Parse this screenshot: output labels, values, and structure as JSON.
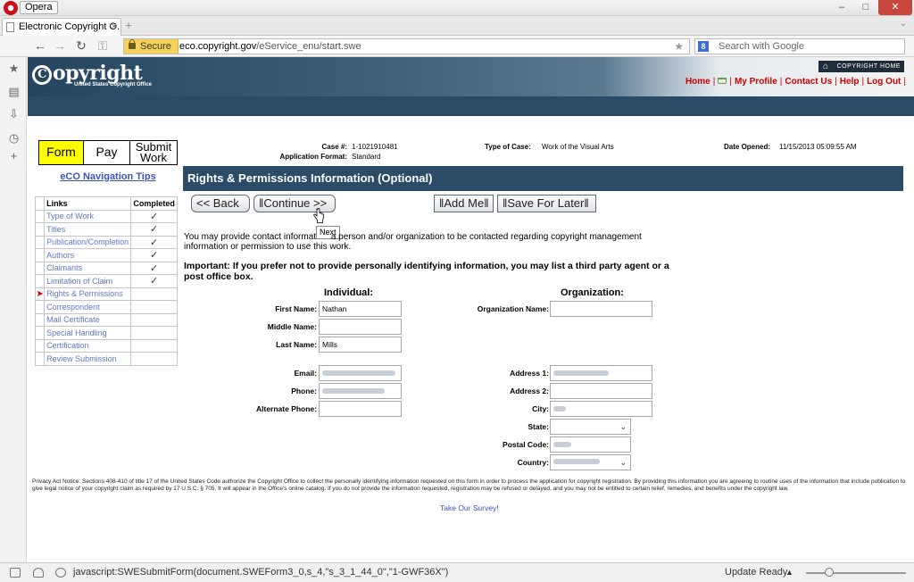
{
  "browser": {
    "menu_label": "Opera",
    "window_controls": {
      "minimize": "–",
      "maximize": "□",
      "close": "✕"
    },
    "tab_title": "Electronic Copyright O...",
    "tab_close": "×",
    "new_tab": "+",
    "secure_label": "Secure",
    "url_domain": "eco.copyright.gov",
    "url_path": "/eService_enu/start.swe",
    "search_placeholder": "Search with Google",
    "search_engine_letter": "8",
    "status_text": "javascript:SWESubmitForm(document.SWEForm3_0,s_4,\"s_3_1_44_0\",\"1-GWF36X\")",
    "update_text": "Update Ready",
    "zoom_level": 0.23,
    "icons": [
      "opera-logo",
      "back-icon",
      "forward-icon",
      "reload-icon",
      "key-icon",
      "lock-icon",
      "star-icon",
      "bookmarks-icon",
      "notes-icon",
      "downloads-icon",
      "history-icon",
      "plus-icon"
    ]
  },
  "site": {
    "logo_text": "opyright",
    "logo_letter": "C",
    "logo_subtitle": "United States Copyright Office",
    "copyright_home": "COPYRIGHT HOME",
    "links": {
      "home": "Home",
      "profile": "My Profile",
      "contact": "Contact Us",
      "help": "Help",
      "logout": "Log Out"
    },
    "link_color": "#cc0000",
    "banner_color": "#2a4a66"
  },
  "nav": {
    "steps": {
      "form": "Form",
      "pay": "Pay",
      "submit_line1": "Submit",
      "submit_line2": "Work"
    },
    "tips": "eCO Navigation Tips",
    "table_headers": {
      "links": "Links",
      "completed": "Completed"
    },
    "check_mark": "✓",
    "current_marker": "➤",
    "items": [
      {
        "label": "Type of Work",
        "completed": true
      },
      {
        "label": "Titles",
        "completed": true
      },
      {
        "label": "Publication/Completion",
        "completed": true
      },
      {
        "label": "Authors",
        "completed": true
      },
      {
        "label": "Claimants",
        "completed": true
      },
      {
        "label": "Limitation of Claim",
        "completed": true
      },
      {
        "label": "Rights & Permissions",
        "completed": false,
        "current": true
      },
      {
        "label": "Correspondent",
        "completed": false
      },
      {
        "label": "Mail Certificate",
        "completed": false
      },
      {
        "label": "Special Handling",
        "completed": false
      },
      {
        "label": "Certification",
        "completed": false
      },
      {
        "label": "Review Submission",
        "completed": false
      }
    ]
  },
  "case": {
    "case_label": "Case #:",
    "case_value": "1-1021910481",
    "format_label": "Application Format:",
    "format_value": "Standard",
    "type_label": "Type of Case:",
    "type_value": "Work of the Visual Arts",
    "opened_label": "Date Opened:",
    "opened_value": "11/15/2013 05:09:55 AM"
  },
  "section": {
    "title": "Rights & Permissions Information (Optional)",
    "buttons": {
      "back": "<< Back",
      "continue": "Continue >>",
      "add_me": "Add Me",
      "save_later": "Save For Later"
    },
    "tooltip": "Next",
    "intro_a": "You may provide contact informat",
    "intro_b": " a person and/or organization to be contacted regarding copyright management information or permission to use this work.",
    "important": "Important: If you prefer not to provide personally identifying information, you may list a third party agent or a post office box."
  },
  "form": {
    "individual_heading": "Individual:",
    "organization_heading": "Organization:",
    "labels": {
      "first_name": "First Name:",
      "middle_name": "Middle Name:",
      "last_name": "Last Name:",
      "email": "Email:",
      "phone": "Phone:",
      "alt_phone": "Alternate Phone:",
      "org_name": "Organization Name:",
      "address1": "Address 1:",
      "address2": "Address 2:",
      "city": "City:",
      "state": "State:",
      "postal": "Postal Code:",
      "country": "Country:"
    },
    "values": {
      "first_name": "Nathan",
      "middle_name": "",
      "last_name": "Mills",
      "org_name": "",
      "address2": ""
    },
    "select_arrow": "⌄"
  },
  "footer": {
    "privacy": "Privacy Act Notice: Sections 408-410 of title 17 of the United States Code authorize the Copyright Office to collect the personally identifying information requested on this form in order to process the application for copyright registration. By providing this information you are agreeing to routine uses of the information that include publication to give legal notice of your copyright claim as required by 17 U.S.C. § 705. It will appear in the Office's online catalog. If you do not provide the information requested, registration may be refused or delayed, and you may not be entitled to certain relief, remedies, and benefits under the copyright law.",
    "survey": "Take Our Survey!"
  }
}
